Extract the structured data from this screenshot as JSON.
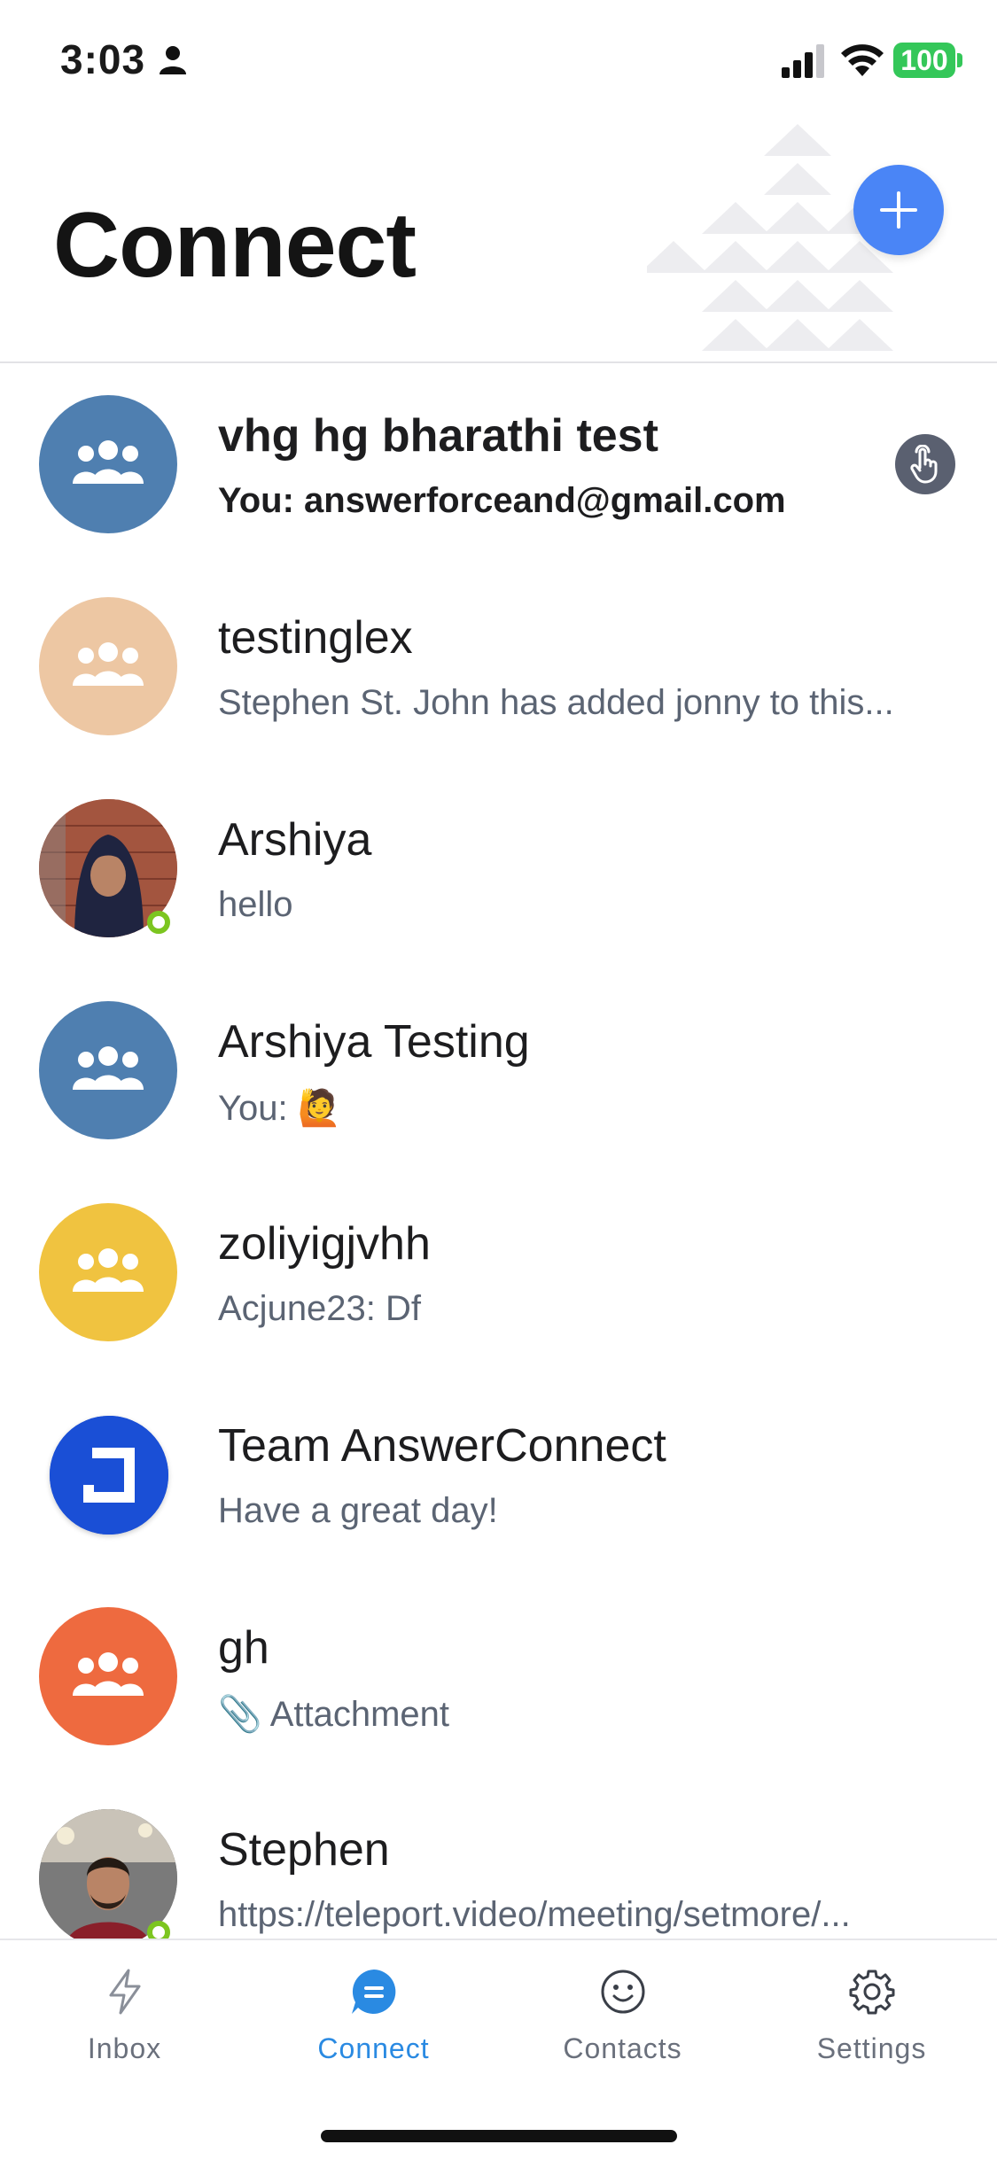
{
  "status_bar": {
    "time": "3:03",
    "battery": "100"
  },
  "header": {
    "title": "Connect"
  },
  "conversations": [
    {
      "name": "vhg hg bharathi test",
      "preview": "You: answerforceand@gmail.com",
      "unread": true,
      "avatar_color": "#4f7fb0",
      "avatar_icon": "group-icon"
    },
    {
      "name": "testinglex",
      "preview": "Stephen St. John has added jonny to this...",
      "avatar_color": "#edc7a3",
      "avatar_icon": "group-icon"
    },
    {
      "name": "Arshiya",
      "preview": "hello",
      "avatar_icon": "profile-photo",
      "online": true
    },
    {
      "name": "Arshiya Testing",
      "preview": "You: 🙋",
      "avatar_color": "#4f7fb0",
      "avatar_icon": "group-icon"
    },
    {
      "name": "zoliyigjvhh",
      "preview": "Acjune23: Df",
      "avatar_color": "#f0c340",
      "avatar_icon": "group-icon"
    },
    {
      "name": "Team AnswerConnect",
      "preview": "Have a great day!",
      "avatar_color": "#1a4fd6",
      "avatar_icon": "answerconnect-logo"
    },
    {
      "name": "gh",
      "preview": "📎 Attachment",
      "avatar_color": "#ee6a3f",
      "avatar_icon": "group-icon"
    },
    {
      "name": "Stephen",
      "preview": "https://teleport.video/meeting/setmore/...",
      "avatar_icon": "profile-photo",
      "online": true
    }
  ],
  "tab_bar": {
    "tabs": [
      {
        "label": "Inbox",
        "icon": "lightning-icon",
        "active": false
      },
      {
        "label": "Connect",
        "icon": "chat-bubble-icon",
        "active": true
      },
      {
        "label": "Contacts",
        "icon": "smiley-icon",
        "active": false
      },
      {
        "label": "Settings",
        "icon": "gear-icon",
        "active": false
      }
    ]
  },
  "colors": {
    "accent": "#2a8ae2",
    "fab": "#4a85f6",
    "online": "#7cc520",
    "battery": "#34c759"
  }
}
